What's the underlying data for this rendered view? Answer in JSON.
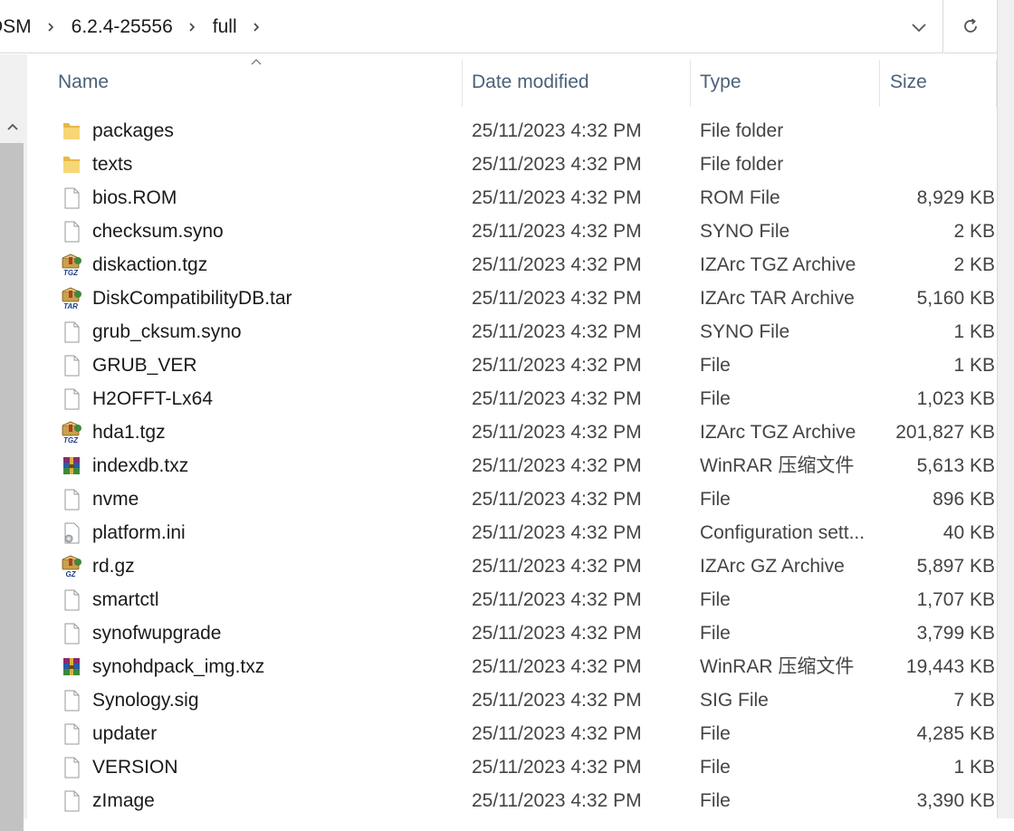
{
  "address": {
    "crumbs": [
      "DSM",
      "6.2.4-25556",
      "full"
    ]
  },
  "columns": {
    "name": "Name",
    "date": "Date modified",
    "type": "Type",
    "size": "Size"
  },
  "files": [
    {
      "name": "packages",
      "date": "25/11/2023 4:32 PM",
      "type": "File folder",
      "size": "",
      "icon": "folder-icon"
    },
    {
      "name": "texts",
      "date": "25/11/2023 4:32 PM",
      "type": "File folder",
      "size": "",
      "icon": "folder-icon"
    },
    {
      "name": "bios.ROM",
      "date": "25/11/2023 4:32 PM",
      "type": "ROM File",
      "size": "8,929 KB",
      "icon": "file-icon"
    },
    {
      "name": "checksum.syno",
      "date": "25/11/2023 4:32 PM",
      "type": "SYNO File",
      "size": "2 KB",
      "icon": "file-icon"
    },
    {
      "name": "diskaction.tgz",
      "date": "25/11/2023 4:32 PM",
      "type": "IZArc TGZ Archive",
      "size": "2 KB",
      "icon": "izarc-tgz-icon"
    },
    {
      "name": "DiskCompatibilityDB.tar",
      "date": "25/11/2023 4:32 PM",
      "type": "IZArc TAR Archive",
      "size": "5,160 KB",
      "icon": "izarc-tar-icon"
    },
    {
      "name": "grub_cksum.syno",
      "date": "25/11/2023 4:32 PM",
      "type": "SYNO File",
      "size": "1 KB",
      "icon": "file-icon"
    },
    {
      "name": "GRUB_VER",
      "date": "25/11/2023 4:32 PM",
      "type": "File",
      "size": "1 KB",
      "icon": "file-icon"
    },
    {
      "name": "H2OFFT-Lx64",
      "date": "25/11/2023 4:32 PM",
      "type": "File",
      "size": "1,023 KB",
      "icon": "file-icon"
    },
    {
      "name": "hda1.tgz",
      "date": "25/11/2023 4:32 PM",
      "type": "IZArc TGZ Archive",
      "size": "201,827 KB",
      "icon": "izarc-tgz-icon"
    },
    {
      "name": "indexdb.txz",
      "date": "25/11/2023 4:32 PM",
      "type": "WinRAR 压缩文件",
      "size": "5,613 KB",
      "icon": "winrar-icon"
    },
    {
      "name": "nvme",
      "date": "25/11/2023 4:32 PM",
      "type": "File",
      "size": "896 KB",
      "icon": "file-icon"
    },
    {
      "name": "platform.ini",
      "date": "25/11/2023 4:32 PM",
      "type": "Configuration sett...",
      "size": "40 KB",
      "icon": "config-file-icon"
    },
    {
      "name": "rd.gz",
      "date": "25/11/2023 4:32 PM",
      "type": "IZArc GZ Archive",
      "size": "5,897 KB",
      "icon": "izarc-gz-icon"
    },
    {
      "name": "smartctl",
      "date": "25/11/2023 4:32 PM",
      "type": "File",
      "size": "1,707 KB",
      "icon": "file-icon"
    },
    {
      "name": "synofwupgrade",
      "date": "25/11/2023 4:32 PM",
      "type": "File",
      "size": "3,799 KB",
      "icon": "file-icon"
    },
    {
      "name": "synohdpack_img.txz",
      "date": "25/11/2023 4:32 PM",
      "type": "WinRAR 压缩文件",
      "size": "19,443 KB",
      "icon": "winrar-icon"
    },
    {
      "name": "Synology.sig",
      "date": "25/11/2023 4:32 PM",
      "type": "SIG File",
      "size": "7 KB",
      "icon": "file-icon"
    },
    {
      "name": "updater",
      "date": "25/11/2023 4:32 PM",
      "type": "File",
      "size": "4,285 KB",
      "icon": "file-icon"
    },
    {
      "name": "VERSION",
      "date": "25/11/2023 4:32 PM",
      "type": "File",
      "size": "1 KB",
      "icon": "file-icon"
    },
    {
      "name": "zImage",
      "date": "25/11/2023 4:32 PM",
      "type": "File",
      "size": "3,390 KB",
      "icon": "file-icon"
    }
  ],
  "icon_labels": {
    "tgz": "TGZ",
    "tar": "TAR",
    "gz": "GZ"
  }
}
